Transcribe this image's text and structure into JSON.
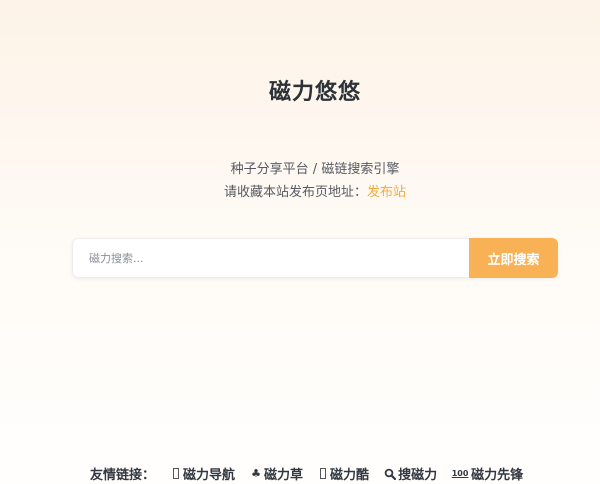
{
  "site": {
    "title": "磁力悠悠",
    "subtitle": "种子分享平台 / 磁链搜索引擎",
    "notice_prefix": "请收藏本站发布页地址：",
    "notice_link": "发布站"
  },
  "search": {
    "placeholder": "磁力搜索...",
    "value": "",
    "button_label": "立即搜索"
  },
  "friend_links": {
    "label": "友情链接：",
    "items": [
      {
        "icon": "box-icon",
        "label": "磁力导航"
      },
      {
        "icon": "club-icon",
        "label": "磁力草"
      },
      {
        "icon": "box-icon",
        "label": "磁力酷"
      },
      {
        "icon": "magnifier-icon",
        "label": "搜磁力"
      },
      {
        "icon": "hundred-points-icon",
        "label": "磁力先锋",
        "icon_text": "100"
      }
    ]
  },
  "colors": {
    "accent": "#f8b154",
    "link": "#f5a93f",
    "title": "#2d3138"
  }
}
